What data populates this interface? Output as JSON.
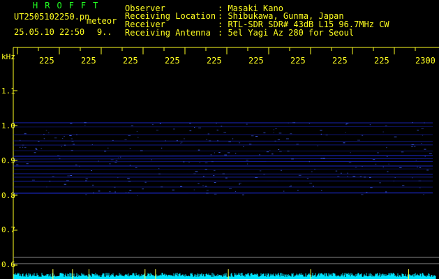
{
  "brand": "HROFFT",
  "file_name": "UT2505102250.pn",
  "mode_label": "meteor",
  "date_time": "25.05.10 22:50",
  "extra_value": "9..",
  "info": {
    "labels": [
      "Observer",
      "Receiving Location",
      "Receiver",
      "Receiving Antenna"
    ],
    "values": [
      ": Masaki Kano",
      ": Shibukawa, Gunma, Japan",
      ": RTL-SDR SDR# 43dB L15 96.7MHz CW",
      ": 5el Yagi Az 280 for Seoul"
    ]
  },
  "y_unit": "kHz",
  "y_ticks": [
    "1.1",
    "1.0",
    "0.9",
    "0.8",
    "0.7",
    "0.6"
  ],
  "x_ticks": [
    "225",
    "225",
    "225",
    "225",
    "225",
    "225",
    "225",
    "225",
    "225",
    "2300"
  ],
  "colors": {
    "text": "#ffff20",
    "title": "#22ff22",
    "signal": "#2233ff",
    "noise": "#00e5ff"
  }
}
